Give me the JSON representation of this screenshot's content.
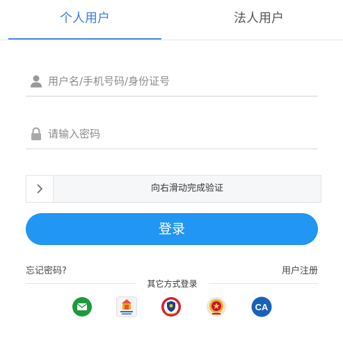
{
  "tabs": [
    {
      "label": "个人用户",
      "active": true
    },
    {
      "label": "法人用户",
      "active": false
    }
  ],
  "form": {
    "username_placeholder": "用户名/手机号码/身份证号",
    "password_placeholder": "请输入密码"
  },
  "slider": {
    "text": "向右滑动完成验证",
    "handle_icon": "chevron-right-icon"
  },
  "login_button": "登录",
  "links": {
    "forgot": "忘记密码?",
    "register": "用户注册"
  },
  "other_login": {
    "label": "其它方式登录",
    "methods": [
      {
        "name": "message-login",
        "icon": "message-icon",
        "color": "#1e9a3c"
      },
      {
        "name": "gov-service-login",
        "icon": "gov-service-icon",
        "color": "#e8503a"
      },
      {
        "name": "public-security-login",
        "icon": "police-badge-icon",
        "color": "#d02030"
      },
      {
        "name": "national-emblem-login",
        "icon": "national-emblem-icon",
        "color": "#c8102e"
      },
      {
        "name": "ca-login",
        "icon": "ca-icon",
        "text": "CA",
        "color": "#1a62b8"
      }
    ]
  },
  "colors": {
    "accent": "#2196f3",
    "tab_active": "#3a7bf0"
  }
}
